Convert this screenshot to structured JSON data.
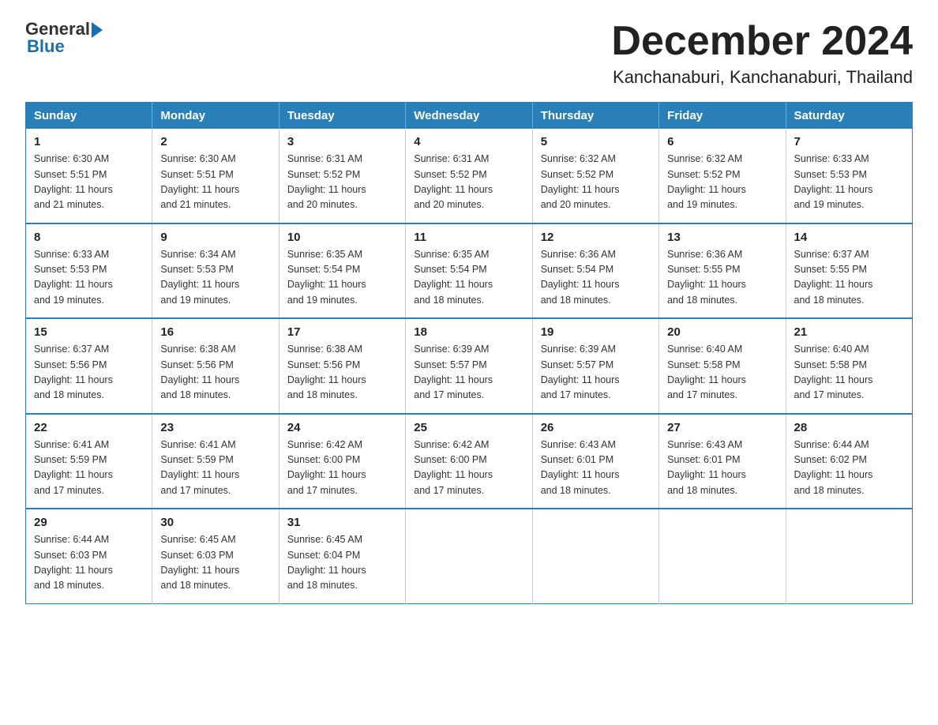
{
  "header": {
    "logo_general": "General",
    "logo_blue": "Blue",
    "title": "December 2024",
    "subtitle": "Kanchanaburi, Kanchanaburi, Thailand"
  },
  "calendar": {
    "days_of_week": [
      "Sunday",
      "Monday",
      "Tuesday",
      "Wednesday",
      "Thursday",
      "Friday",
      "Saturday"
    ],
    "weeks": [
      [
        {
          "day": "1",
          "sunrise": "6:30 AM",
          "sunset": "5:51 PM",
          "daylight": "11 hours and 21 minutes."
        },
        {
          "day": "2",
          "sunrise": "6:30 AM",
          "sunset": "5:51 PM",
          "daylight": "11 hours and 21 minutes."
        },
        {
          "day": "3",
          "sunrise": "6:31 AM",
          "sunset": "5:52 PM",
          "daylight": "11 hours and 20 minutes."
        },
        {
          "day": "4",
          "sunrise": "6:31 AM",
          "sunset": "5:52 PM",
          "daylight": "11 hours and 20 minutes."
        },
        {
          "day": "5",
          "sunrise": "6:32 AM",
          "sunset": "5:52 PM",
          "daylight": "11 hours and 20 minutes."
        },
        {
          "day": "6",
          "sunrise": "6:32 AM",
          "sunset": "5:52 PM",
          "daylight": "11 hours and 19 minutes."
        },
        {
          "day": "7",
          "sunrise": "6:33 AM",
          "sunset": "5:53 PM",
          "daylight": "11 hours and 19 minutes."
        }
      ],
      [
        {
          "day": "8",
          "sunrise": "6:33 AM",
          "sunset": "5:53 PM",
          "daylight": "11 hours and 19 minutes."
        },
        {
          "day": "9",
          "sunrise": "6:34 AM",
          "sunset": "5:53 PM",
          "daylight": "11 hours and 19 minutes."
        },
        {
          "day": "10",
          "sunrise": "6:35 AM",
          "sunset": "5:54 PM",
          "daylight": "11 hours and 19 minutes."
        },
        {
          "day": "11",
          "sunrise": "6:35 AM",
          "sunset": "5:54 PM",
          "daylight": "11 hours and 18 minutes."
        },
        {
          "day": "12",
          "sunrise": "6:36 AM",
          "sunset": "5:54 PM",
          "daylight": "11 hours and 18 minutes."
        },
        {
          "day": "13",
          "sunrise": "6:36 AM",
          "sunset": "5:55 PM",
          "daylight": "11 hours and 18 minutes."
        },
        {
          "day": "14",
          "sunrise": "6:37 AM",
          "sunset": "5:55 PM",
          "daylight": "11 hours and 18 minutes."
        }
      ],
      [
        {
          "day": "15",
          "sunrise": "6:37 AM",
          "sunset": "5:56 PM",
          "daylight": "11 hours and 18 minutes."
        },
        {
          "day": "16",
          "sunrise": "6:38 AM",
          "sunset": "5:56 PM",
          "daylight": "11 hours and 18 minutes."
        },
        {
          "day": "17",
          "sunrise": "6:38 AM",
          "sunset": "5:56 PM",
          "daylight": "11 hours and 18 minutes."
        },
        {
          "day": "18",
          "sunrise": "6:39 AM",
          "sunset": "5:57 PM",
          "daylight": "11 hours and 17 minutes."
        },
        {
          "day": "19",
          "sunrise": "6:39 AM",
          "sunset": "5:57 PM",
          "daylight": "11 hours and 17 minutes."
        },
        {
          "day": "20",
          "sunrise": "6:40 AM",
          "sunset": "5:58 PM",
          "daylight": "11 hours and 17 minutes."
        },
        {
          "day": "21",
          "sunrise": "6:40 AM",
          "sunset": "5:58 PM",
          "daylight": "11 hours and 17 minutes."
        }
      ],
      [
        {
          "day": "22",
          "sunrise": "6:41 AM",
          "sunset": "5:59 PM",
          "daylight": "11 hours and 17 minutes."
        },
        {
          "day": "23",
          "sunrise": "6:41 AM",
          "sunset": "5:59 PM",
          "daylight": "11 hours and 17 minutes."
        },
        {
          "day": "24",
          "sunrise": "6:42 AM",
          "sunset": "6:00 PM",
          "daylight": "11 hours and 17 minutes."
        },
        {
          "day": "25",
          "sunrise": "6:42 AM",
          "sunset": "6:00 PM",
          "daylight": "11 hours and 17 minutes."
        },
        {
          "day": "26",
          "sunrise": "6:43 AM",
          "sunset": "6:01 PM",
          "daylight": "11 hours and 18 minutes."
        },
        {
          "day": "27",
          "sunrise": "6:43 AM",
          "sunset": "6:01 PM",
          "daylight": "11 hours and 18 minutes."
        },
        {
          "day": "28",
          "sunrise": "6:44 AM",
          "sunset": "6:02 PM",
          "daylight": "11 hours and 18 minutes."
        }
      ],
      [
        {
          "day": "29",
          "sunrise": "6:44 AM",
          "sunset": "6:03 PM",
          "daylight": "11 hours and 18 minutes."
        },
        {
          "day": "30",
          "sunrise": "6:45 AM",
          "sunset": "6:03 PM",
          "daylight": "11 hours and 18 minutes."
        },
        {
          "day": "31",
          "sunrise": "6:45 AM",
          "sunset": "6:04 PM",
          "daylight": "11 hours and 18 minutes."
        },
        null,
        null,
        null,
        null
      ]
    ],
    "labels": {
      "sunrise": "Sunrise:",
      "sunset": "Sunset:",
      "daylight": "Daylight:"
    }
  }
}
